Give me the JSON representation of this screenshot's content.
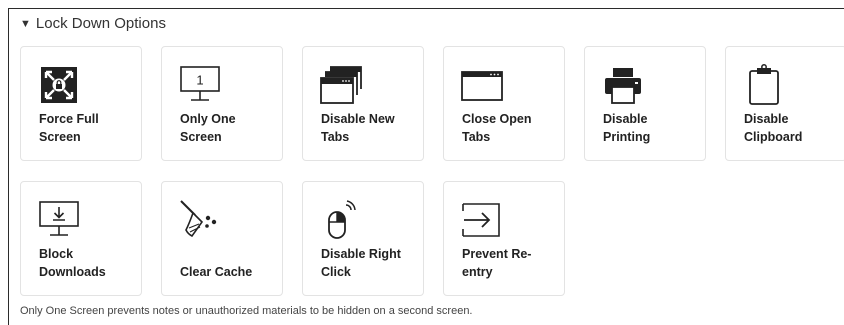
{
  "section": {
    "caret": "▼",
    "title": "Lock Down Options"
  },
  "tiles": [
    {
      "label": "Force Full\nScreen",
      "icon": "fullscreen-lock-icon"
    },
    {
      "label": "Only One\nScreen",
      "icon": "one-monitor-icon",
      "icon_text": "1"
    },
    {
      "label": "Disable New\nTabs",
      "icon": "new-tabs-icon"
    },
    {
      "label": "Close Open\nTabs",
      "icon": "browser-window-icon"
    },
    {
      "label": "Disable\nPrinting",
      "icon": "printer-icon"
    },
    {
      "label": "Disable\nClipboard",
      "icon": "clipboard-icon"
    },
    {
      "label": "Block\nDownloads",
      "icon": "download-monitor-icon"
    },
    {
      "label": "Clear Cache",
      "icon": "broom-icon"
    },
    {
      "label": "Disable Right\nClick",
      "icon": "mouse-right-click-icon"
    },
    {
      "label": "Prevent Re-\nentry",
      "icon": "enter-arrow-icon"
    }
  ],
  "footnote": "Only One Screen prevents notes or unauthorized materials to be hidden on a second screen.",
  "colors": {
    "icon": "#222222",
    "tile_border": "#e3e3e3",
    "panel_border": "#2b2b2b"
  }
}
